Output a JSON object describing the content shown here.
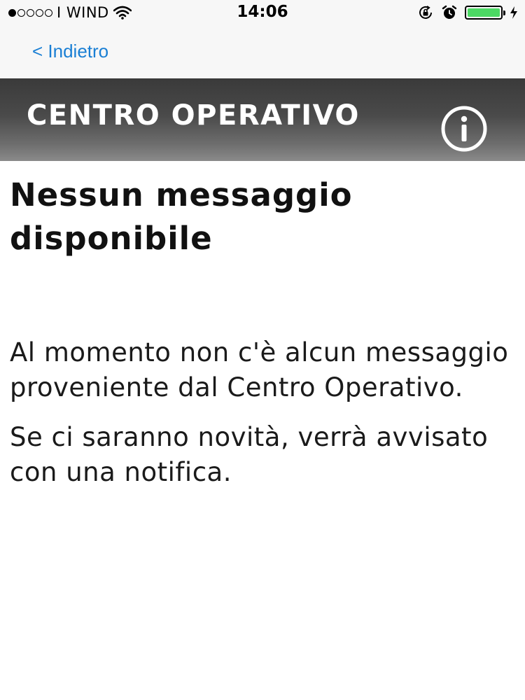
{
  "status_bar": {
    "signal_filled": 1,
    "signal_total": 5,
    "carrier": "I WIND",
    "time": "14:06",
    "battery_level": 1.0,
    "battery_color": "#4cd964",
    "icons": [
      "wifi-icon",
      "orientation-lock-icon",
      "alarm-icon",
      "battery-icon",
      "charging-bolt-icon"
    ]
  },
  "nav": {
    "back_label": "< Indietro",
    "accent": "#1a7fd4"
  },
  "header": {
    "title": "CENTRO OPERATIVO",
    "info_icon": "info-icon"
  },
  "content": {
    "heading": "Nessun messaggio disponibile",
    "paragraph_1": "Al momento non c'è alcun messaggio proveniente dal Centro Operativo.",
    "paragraph_2": "Se ci saranno novità, verrà avvisato con una notifica."
  }
}
